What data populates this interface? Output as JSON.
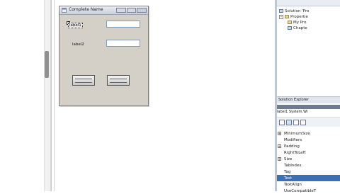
{
  "form": {
    "title": "Complete Name",
    "label1": "label1",
    "label2": "label2",
    "textbox1_value": "",
    "textbox2_value": ""
  },
  "solution_explorer": {
    "items": [
      {
        "label": "Solution 'Pro"
      },
      {
        "label": "Propertie"
      },
      {
        "label": "My Pro"
      },
      {
        "label": "Chapte"
      }
    ],
    "tab": "Solution Explorer"
  },
  "properties": {
    "object": "label1 System.Wi",
    "rows": [
      {
        "label": "MinimumSize",
        "expandable": true
      },
      {
        "label": "Modifiers",
        "expandable": false
      },
      {
        "label": "Padding",
        "expandable": true
      },
      {
        "label": "RightToLeft",
        "expandable": false
      },
      {
        "label": "Size",
        "expandable": true
      },
      {
        "label": "TabIndex",
        "expandable": false
      },
      {
        "label": "Tag",
        "expandable": false
      },
      {
        "label": "Text",
        "expandable": false,
        "selected": true
      },
      {
        "label": "TextAlign",
        "expandable": false
      },
      {
        "label": "UseCompatibleT",
        "expandable": false
      }
    ]
  },
  "colors": {
    "accent": "#3b6fb6",
    "form_background": "#d4d0c8"
  }
}
